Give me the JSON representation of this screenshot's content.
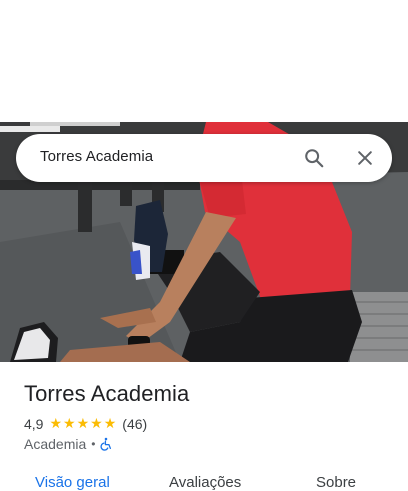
{
  "search": {
    "query": "Torres Academia"
  },
  "icons": {
    "search": "search-icon",
    "close": "close-icon",
    "star": "star-icon",
    "accessibility": "wheelchair-icon"
  },
  "photo": {
    "description_icon": "gym-photo"
  },
  "place": {
    "name": "Torres Academia",
    "rating": "4,9",
    "stars": [
      "★",
      "★",
      "★",
      "★",
      "★"
    ],
    "review_count": "(46)",
    "category": "Academia",
    "separator": "•"
  },
  "tabs": [
    {
      "label": "Visão geral",
      "active": true
    },
    {
      "label": "Avaliações",
      "active": false
    },
    {
      "label": "Sobre",
      "active": false
    }
  ],
  "colors": {
    "accent": "#1a73e8",
    "star": "#fbbc04",
    "shirt": "#e0303a"
  }
}
